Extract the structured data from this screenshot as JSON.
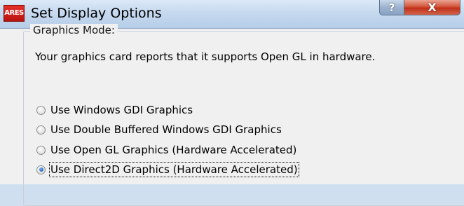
{
  "window": {
    "title": "Set Display Options",
    "app_icon_text": "ARES",
    "help_label": "?",
    "close_label": "X"
  },
  "graphics_group": {
    "label": "Graphics Mode:",
    "info": "Your graphics card reports that it supports Open GL in hardware.",
    "options": [
      {
        "label": "Use Windows GDI Graphics",
        "checked": false
      },
      {
        "label": "Use Double Buffered Windows GDI Graphics",
        "checked": false
      },
      {
        "label": "Use Open GL Graphics (Hardware Accelerated)",
        "checked": false
      },
      {
        "label": "Use Direct2D Graphics (Hardware Accelerated)",
        "checked": true
      }
    ]
  },
  "colors": {
    "titlebar": "#c6d9ef",
    "client_bg": "#f0f0f0",
    "close_button": "#c0301a",
    "radio_selected": "#2b6fc2"
  }
}
